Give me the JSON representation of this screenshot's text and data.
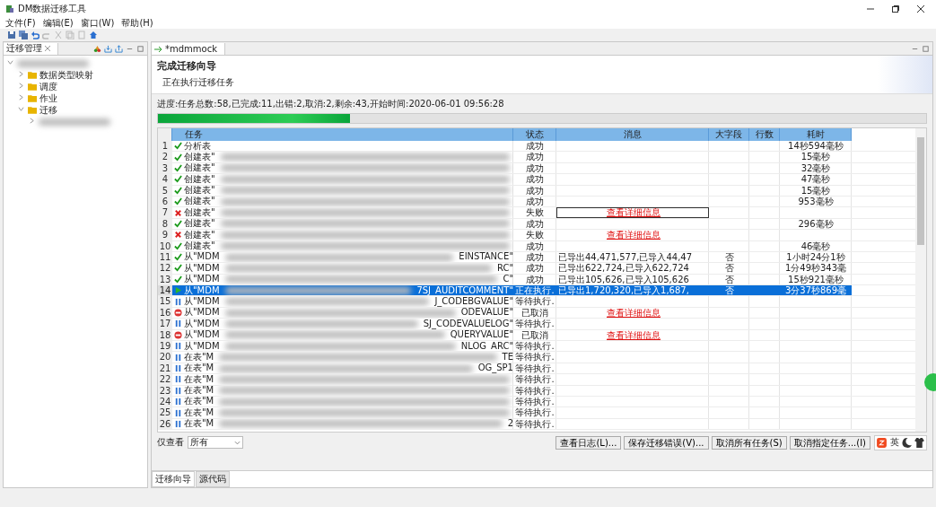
{
  "window": {
    "title": "DM数据迁移工具"
  },
  "menu": [
    "文件(F)",
    "编辑(E)",
    "窗口(W)",
    "帮助(H)"
  ],
  "left_pane": {
    "tab": "迁移管理",
    "tree": [
      {
        "expanded": true,
        "children": [
          {
            "label": "数据类型映射",
            "expanded": false
          },
          {
            "label": "调度",
            "expanded": false
          },
          {
            "label": "作业",
            "expanded": false
          },
          {
            "label": "迁移",
            "expanded": true,
            "children": [
              {
                "expanded": false
              }
            ]
          }
        ]
      }
    ]
  },
  "editor": {
    "tab": "*mdmmock",
    "title": "完成迁移向导",
    "subtitle": "正在执行迁移任务",
    "progress_text": "进度:任务总数:58,已完成:11,出错:2,取消:2,剩余:43,开始时间:2020-06-01 09:56:28",
    "level": 0.25
  },
  "table": {
    "columns": [
      "任务",
      "状态",
      "消息",
      "大字段",
      "行数",
      "耗时"
    ],
    "rows": [
      {
        "n": "1",
        "kind": "success",
        "task": "分析表",
        "blurred": false,
        "suffix": "",
        "status": "成功",
        "message": "",
        "link": "",
        "big": "",
        "time": "14秒594毫秒",
        "selected": false,
        "focused": false
      },
      {
        "n": "2",
        "kind": "success",
        "task": "创建表\"",
        "blurred": true,
        "suffix": "",
        "status": "成功",
        "message": "",
        "link": "",
        "big": "",
        "time": "15毫秒",
        "selected": false,
        "focused": false
      },
      {
        "n": "3",
        "kind": "success",
        "task": "创建表\"",
        "blurred": true,
        "suffix": "",
        "status": "成功",
        "message": "",
        "link": "",
        "big": "",
        "time": "32毫秒",
        "selected": false,
        "focused": false
      },
      {
        "n": "4",
        "kind": "success",
        "task": "创建表\"",
        "blurred": true,
        "suffix": "",
        "status": "成功",
        "message": "",
        "link": "",
        "big": "",
        "time": "47毫秒",
        "selected": false,
        "focused": false
      },
      {
        "n": "5",
        "kind": "success",
        "task": "创建表\"",
        "blurred": true,
        "suffix": "",
        "status": "成功",
        "message": "",
        "link": "",
        "big": "",
        "time": "15毫秒",
        "selected": false,
        "focused": false
      },
      {
        "n": "6",
        "kind": "success",
        "task": "创建表\"",
        "blurred": true,
        "suffix": "",
        "status": "成功",
        "message": "",
        "link": "",
        "big": "",
        "time": "953毫秒",
        "selected": false,
        "focused": false
      },
      {
        "n": "7",
        "kind": "fail",
        "task": "创建表\"",
        "blurred": true,
        "suffix": "",
        "status": "失败",
        "message": "",
        "link": "查看详细信息",
        "big": "",
        "time": "",
        "selected": false,
        "focused": true
      },
      {
        "n": "8",
        "kind": "success",
        "task": "创建表\"",
        "blurred": true,
        "suffix": "",
        "status": "成功",
        "message": "",
        "link": "",
        "big": "",
        "time": "296毫秒",
        "selected": false,
        "focused": false
      },
      {
        "n": "9",
        "kind": "fail",
        "task": "创建表\"",
        "blurred": true,
        "suffix": "",
        "status": "失败",
        "message": "",
        "link": "查看详细信息",
        "big": "",
        "time": "",
        "selected": false,
        "focused": false
      },
      {
        "n": "10",
        "kind": "success",
        "task": "创建表\"",
        "blurred": true,
        "suffix": "",
        "status": "成功",
        "message": "",
        "link": "",
        "big": "",
        "time": "46毫秒",
        "selected": false,
        "focused": false
      },
      {
        "n": "11",
        "kind": "success",
        "task": "从\"MDM",
        "blurred": true,
        "suffix": "EINSTANCE\"",
        "status": "成功",
        "message": "已导出44,471,577,已导入44,47",
        "link": "",
        "big": "否",
        "time": "1小时24分1秒",
        "selected": false,
        "focused": false
      },
      {
        "n": "12",
        "kind": "success",
        "task": "从\"MDM",
        "blurred": true,
        "suffix": "RC\"",
        "status": "成功",
        "message": "已导出622,724,已导入622,724",
        "link": "",
        "big": "否",
        "time": "1分49秒343毫",
        "selected": false,
        "focused": false
      },
      {
        "n": "13",
        "kind": "success",
        "task": "从\"MDM",
        "blurred": true,
        "suffix": "C\"",
        "status": "成功",
        "message": "已导出105,626,已导入105,626",
        "link": "",
        "big": "否",
        "time": "15秒921毫秒",
        "selected": false,
        "focused": false
      },
      {
        "n": "14",
        "kind": "running",
        "task": "从\"MDM",
        "blurred": true,
        "suffix": "7SJ_AUDITCOMMENT\"",
        "status": "正在执行.",
        "message": "已导出1,720,320,已导入1,687,",
        "link": "",
        "big": "否",
        "time": "3分37秒869毫",
        "selected": true,
        "focused": false
      },
      {
        "n": "15",
        "kind": "waiting",
        "task": "从\"MDM",
        "blurred": true,
        "suffix": "J_CODEBGVALUE\"",
        "status": "等待执行.",
        "message": "",
        "link": "",
        "big": "",
        "time": "",
        "selected": false,
        "focused": false
      },
      {
        "n": "16",
        "kind": "cancelled",
        "task": "从\"MDM",
        "blurred": true,
        "suffix": "ODEVALUE\"",
        "status": "已取消",
        "message": "",
        "link": "查看详细信息",
        "big": "",
        "time": "",
        "selected": false,
        "focused": false
      },
      {
        "n": "17",
        "kind": "waiting",
        "task": "从\"MDM",
        "blurred": true,
        "suffix": "SJ_CODEVALUELOG\"",
        "status": "等待执行.",
        "message": "",
        "link": "",
        "big": "",
        "time": "",
        "selected": false,
        "focused": false
      },
      {
        "n": "18",
        "kind": "cancelled",
        "task": "从\"MDM",
        "blurred": true,
        "suffix": "QUERYVALUE\"",
        "status": "已取消",
        "message": "",
        "link": "查看详细信息",
        "big": "",
        "time": "",
        "selected": false,
        "focused": false
      },
      {
        "n": "19",
        "kind": "waiting",
        "task": "从\"MDM",
        "blurred": true,
        "suffix": "NLOG_ARC\"",
        "status": "等待执行.",
        "message": "",
        "link": "",
        "big": "",
        "time": "",
        "selected": false,
        "focused": false
      },
      {
        "n": "20",
        "kind": "waiting",
        "task": "在表\"M",
        "blurred": true,
        "suffix": "TE",
        "status": "等待执行.",
        "message": "",
        "link": "",
        "big": "",
        "time": "",
        "selected": false,
        "focused": false
      },
      {
        "n": "21",
        "kind": "waiting",
        "task": "在表\"M",
        "blurred": true,
        "suffix": "OG_SP1",
        "status": "等待执行.",
        "message": "",
        "link": "",
        "big": "",
        "time": "",
        "selected": false,
        "focused": false
      },
      {
        "n": "22",
        "kind": "waiting",
        "task": "在表\"M",
        "blurred": true,
        "suffix": "",
        "status": "等待执行.",
        "message": "",
        "link": "",
        "big": "",
        "time": "",
        "selected": false,
        "focused": false
      },
      {
        "n": "23",
        "kind": "waiting",
        "task": "在表\"M",
        "blurred": true,
        "suffix": "",
        "status": "等待执行.",
        "message": "",
        "link": "",
        "big": "",
        "time": "",
        "selected": false,
        "focused": false
      },
      {
        "n": "24",
        "kind": "waiting",
        "task": "在表\"M",
        "blurred": true,
        "suffix": "",
        "status": "等待执行.",
        "message": "",
        "link": "",
        "big": "",
        "time": "",
        "selected": false,
        "focused": false
      },
      {
        "n": "25",
        "kind": "waiting",
        "task": "在表\"M",
        "blurred": true,
        "suffix": "",
        "status": "等待执行.",
        "message": "",
        "link": "",
        "big": "",
        "time": "",
        "selected": false,
        "focused": false
      },
      {
        "n": "26",
        "kind": "waiting",
        "task": "在表\"M",
        "blurred": true,
        "suffix": "2",
        "status": "等待执行.",
        "message": "",
        "link": "",
        "big": "",
        "time": "",
        "selected": false,
        "focused": false
      }
    ]
  },
  "filter": {
    "label": "仅查看",
    "value": "所有"
  },
  "buttons": [
    "查看日志(L)...",
    "保存迁移错误(V)...",
    "取消所有任务(S)",
    "取消指定任务...(I)"
  ],
  "ime_bar": {
    "mode": "英"
  },
  "bottom_tabs": [
    {
      "label": "迁移向导",
      "selected": true
    },
    {
      "label": "源代码",
      "selected": false
    }
  ]
}
